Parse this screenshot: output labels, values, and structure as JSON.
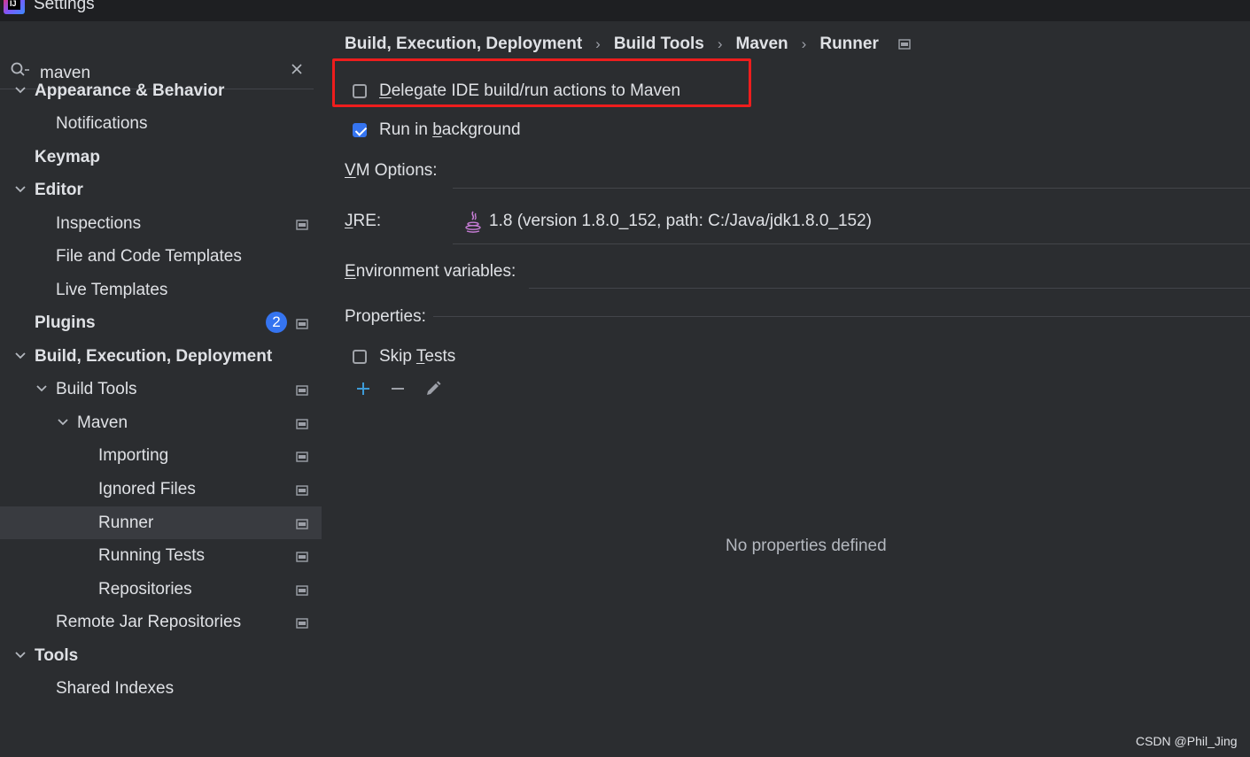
{
  "window": {
    "title": "Settings"
  },
  "search": {
    "query": "maven"
  },
  "tree": [
    {
      "id": "appearance-behavior",
      "label": "Appearance & Behavior",
      "bold": true
    },
    {
      "id": "notifications",
      "label": "Notifications"
    },
    {
      "id": "keymap",
      "label": "Keymap",
      "bold": true
    },
    {
      "id": "editor",
      "label": "Editor",
      "bold": true
    },
    {
      "id": "inspections",
      "label": "Inspections"
    },
    {
      "id": "file-code-templates",
      "label": "File and Code Templates"
    },
    {
      "id": "live-templates",
      "label": "Live Templates"
    },
    {
      "id": "plugins",
      "label": "Plugins",
      "bold": true,
      "badge": "2"
    },
    {
      "id": "build-execution-deployment",
      "label": "Build, Execution, Deployment",
      "bold": true
    },
    {
      "id": "build-tools",
      "label": "Build Tools"
    },
    {
      "id": "maven",
      "label": "Maven"
    },
    {
      "id": "importing",
      "label": "Importing"
    },
    {
      "id": "ignored-files",
      "label": "Ignored Files"
    },
    {
      "id": "runner",
      "label": "Runner",
      "selected": true
    },
    {
      "id": "running-tests",
      "label": "Running Tests"
    },
    {
      "id": "repositories",
      "label": "Repositories"
    },
    {
      "id": "remote-jar-repositories",
      "label": "Remote Jar Repositories"
    },
    {
      "id": "tools",
      "label": "Tools",
      "bold": true
    },
    {
      "id": "shared-indexes",
      "label": "Shared Indexes"
    }
  ],
  "breadcrumb": [
    "Build, Execution, Deployment",
    "Build Tools",
    "Maven",
    "Runner"
  ],
  "runner": {
    "delegate": {
      "pre": "",
      "key": "D",
      "post": "elegate IDE build/run actions to Maven",
      "checked": false
    },
    "background": {
      "pre": "Run in ",
      "key": "b",
      "post": "ackground",
      "checked": true
    },
    "vm_options": {
      "key": "V",
      "post": "M Options:",
      "value": ""
    },
    "jre": {
      "key": "J",
      "post": "RE:",
      "value": "1.8 (version 1.8.0_152, path: C:/Java/jdk1.8.0_152)"
    },
    "env": {
      "key": "E",
      "post": "nvironment variables:",
      "value": ""
    },
    "properties": {
      "label": "Properties:"
    },
    "skip_tests": {
      "pre": "Skip ",
      "key": "T",
      "post": "ests",
      "checked": false
    },
    "empty_text": "No properties defined"
  },
  "colors": {
    "background": "#2b2d30",
    "selection": "#393b40",
    "accent": "#3574f0",
    "add_icon": "#3d9bd8",
    "highlight": "#ee1d1d"
  },
  "watermark": "CSDN @Phil_Jing"
}
